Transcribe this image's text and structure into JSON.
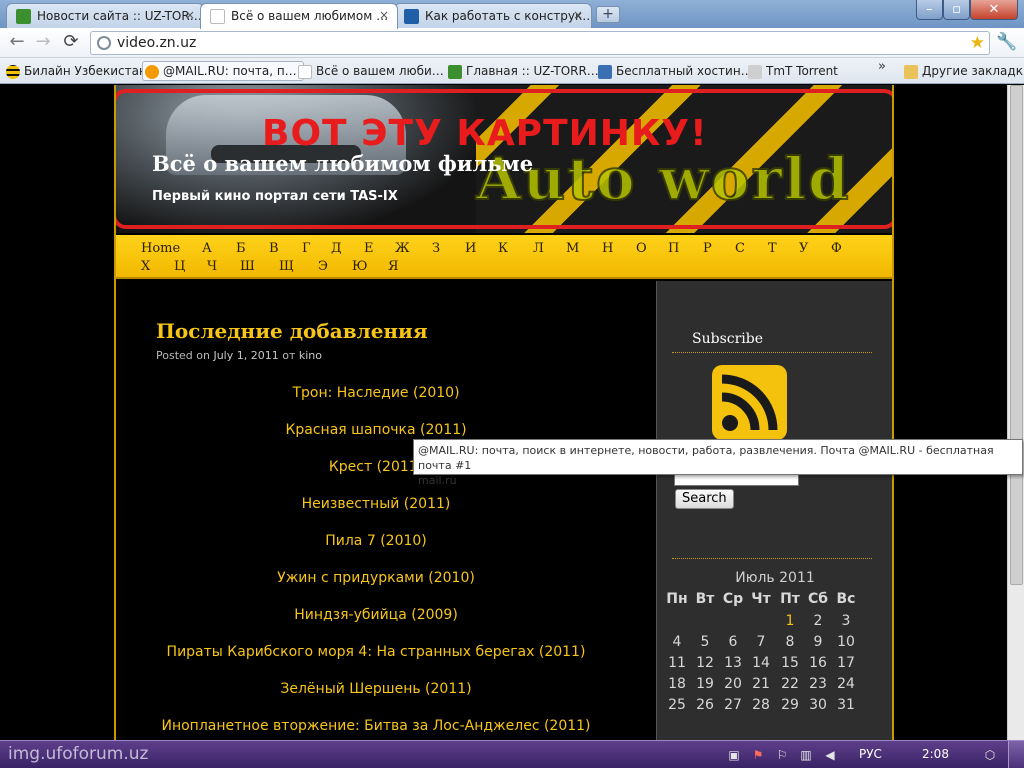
{
  "browser": {
    "tabs": [
      {
        "label": "Новости сайта :: UZ-TOR…",
        "favicon_color": "#3c8f2f"
      },
      {
        "label": "Всё о вашем любимом …",
        "favicon_color": "#ffffff"
      },
      {
        "label": "Как работать с конструк…",
        "favicon_color": "#1f5fa8"
      }
    ],
    "new_tab": "+",
    "close_glyph": "×",
    "window_buttons": {
      "minimize": "–",
      "maximize": "▫",
      "close": "✕"
    },
    "url": "video.zn.uz",
    "bookmarks": [
      {
        "label": "Билайн Узбекистан",
        "color": "#f2c200"
      },
      {
        "label": "@MAIL.RU: почта, п…",
        "color": "#f29a00"
      },
      {
        "label": "Всё о вашем люби…",
        "color": "#ffffff"
      },
      {
        "label": "Главная :: UZ-TORR…",
        "color": "#3c8f2f"
      },
      {
        "label": "Бесплатный хостин…",
        "color": "#3b6fb3"
      },
      {
        "label": "TmT Torrent",
        "color": "#cfcfcf"
      }
    ],
    "bookmarks_more": "»",
    "other_bookmarks": "Другие закладки"
  },
  "site": {
    "annotation": "ВОТ ЭТУ КАРТИНКУ!",
    "banner_brand": "Auto world",
    "title": "Всё о вашем любимом фильме",
    "description": "Первый кино портал сети TAS-IX",
    "nav_row1": [
      "Home",
      "А",
      "Б",
      "В",
      "Г",
      "Д",
      "Е",
      "Ж",
      "З",
      "И",
      "К",
      "Л",
      "М",
      "Н",
      "О",
      "П",
      "Р",
      "С",
      "Т",
      "У",
      "Ф"
    ],
    "nav_row2": [
      "Х",
      "Ц",
      "Ч",
      "Ш",
      "Щ",
      "Э",
      "Ю",
      "Я"
    ],
    "post": {
      "title": "Последние добавления",
      "meta_prefix": "Posted on",
      "date": "July 1, 2011",
      "meta_by": "от",
      "author": "kino"
    },
    "movies": [
      "Трон: Наследие (2010)",
      "Красная шапочка (2011)",
      "Крест (2011)",
      "Неизвестный (2011)",
      "Пила 7 (2010)",
      "Ужин с придурками (2010)",
      "Ниндзя-убийца (2009)",
      "Пираты Карибского моря 4: На странных берегах (2011)",
      "Зелёный Шершень (2011)",
      "Инопланетное вторжение: Битва за Лос-Анджелес (2011)"
    ],
    "sidebar": {
      "subscribe_title": "Subscribe",
      "search_button": "Search",
      "calendar": {
        "caption": "Июль 2011",
        "weekdays": [
          "Пн",
          "Вт",
          "Ср",
          "Чт",
          "Пт",
          "Сб",
          "Вс"
        ],
        "weeks": [
          [
            "",
            "",
            "",
            "",
            "1",
            "2",
            "3"
          ],
          [
            "4",
            "5",
            "6",
            "7",
            "8",
            "9",
            "10"
          ],
          [
            "11",
            "12",
            "13",
            "14",
            "15",
            "16",
            "17"
          ],
          [
            "18",
            "19",
            "20",
            "21",
            "22",
            "23",
            "24"
          ],
          [
            "25",
            "26",
            "27",
            "28",
            "29",
            "30",
            "31"
          ]
        ],
        "linked_day": "1"
      }
    }
  },
  "tooltip": {
    "line1": "@MAIL.RU: почта, поиск в интернете, новости, работа, развлечения. Почта @MAIL.RU - бесплатная почта #1",
    "line2": "mail.ru"
  },
  "taskbar": {
    "watermark": "img.ufoforum.uz",
    "language": "РУС",
    "clock": "2:08"
  },
  "colors": {
    "accent_yellow": "#f6c517",
    "annotation_red": "#e02020",
    "nav_yellow": "#ffd21a"
  }
}
